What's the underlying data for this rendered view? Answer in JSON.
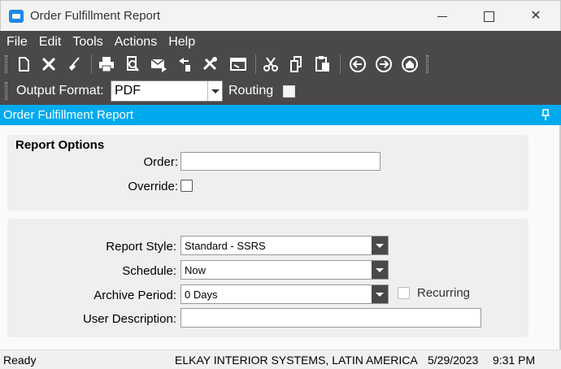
{
  "window": {
    "title": "Order Fulfillment Report",
    "close_glyph": "✕"
  },
  "menu": [
    "File",
    "Edit",
    "Tools",
    "Actions",
    "Help"
  ],
  "toolbar_icons": [
    "new-icon",
    "delete-icon",
    "clear-icon",
    "print-icon",
    "print-preview-icon",
    "send-email-icon",
    "attach-icon",
    "tools-icon",
    "window-icon",
    "cut-icon",
    "copy-icon",
    "paste-icon",
    "back-icon",
    "forward-icon",
    "home-icon"
  ],
  "options": {
    "output_format_label": "Output Format:",
    "output_format_value": "PDF",
    "routing_label": "Routing"
  },
  "header": {
    "title": "Order Fulfillment Report"
  },
  "report_options": {
    "title": "Report Options",
    "order_label": "Order:",
    "order_value": "",
    "override_label": "Override:"
  },
  "report_settings": {
    "style_label": "Report Style:",
    "style_value": "Standard - SSRS",
    "schedule_label": "Schedule:",
    "schedule_value": "Now",
    "archive_label": "Archive Period:",
    "archive_value": "0 Days",
    "recurring_label": "Recurring",
    "user_desc_label": "User Description:",
    "user_desc_value": ""
  },
  "status": {
    "text": "Ready",
    "company": "ELKAY INTERIOR SYSTEMS, LATIN AMERICA",
    "date": "5/29/2023",
    "time": "9:31 PM"
  },
  "colors": {
    "accent_blue": "#00aaee",
    "toolbar_dark": "#4a4848"
  }
}
